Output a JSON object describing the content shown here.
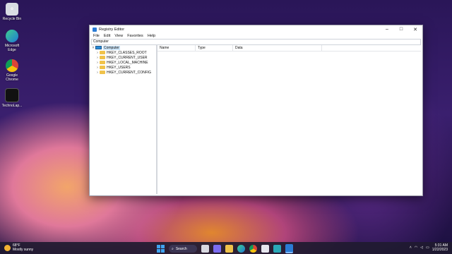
{
  "desktop": {
    "icons": [
      {
        "label": "Recycle Bin"
      },
      {
        "label": "Microsoft Edge"
      },
      {
        "label": "Google Chrome"
      },
      {
        "label": "TechnoLap..."
      }
    ]
  },
  "window": {
    "title": "Registry Editor",
    "menu": [
      "File",
      "Edit",
      "View",
      "Favorites",
      "Help"
    ],
    "address": "Computer",
    "tree": {
      "root": "Computer",
      "keys": [
        "HKEY_CLASSES_ROOT",
        "HKEY_CURRENT_USER",
        "HKEY_LOCAL_MACHINE",
        "HKEY_USERS",
        "HKEY_CURRENT_CONFIG"
      ]
    },
    "columns": [
      "Name",
      "Type",
      "Data"
    ]
  },
  "taskbar": {
    "weather_temp": "68°F",
    "weather_desc": "Mostly sunny",
    "search_label": "Search",
    "time": "5:31 AM",
    "date": "1/22/2023"
  }
}
